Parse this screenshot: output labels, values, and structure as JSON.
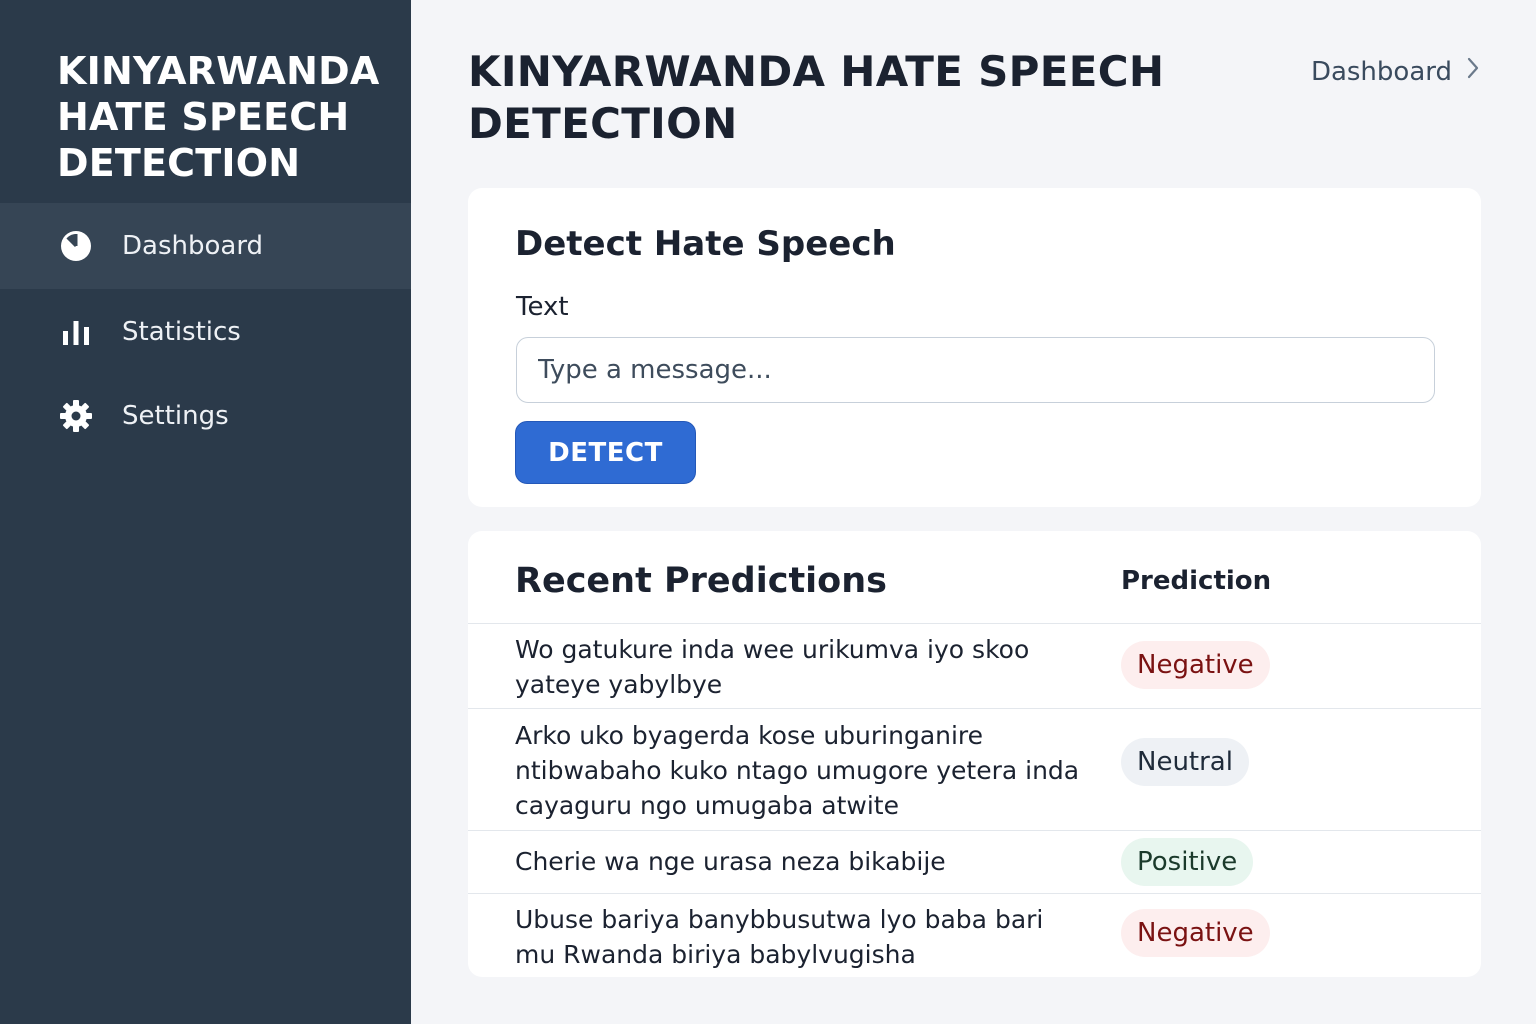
{
  "sidebar": {
    "brand_lines": [
      "KINYARWANDA",
      "HATE SPEECH",
      "DETECTION"
    ],
    "items": [
      {
        "label": "Dashboard",
        "icon": "clock-icon",
        "active": true
      },
      {
        "label": "Statistics",
        "icon": "bar-chart-icon",
        "active": false
      },
      {
        "label": "Settings",
        "icon": "gear-icon",
        "active": false
      }
    ]
  },
  "header": {
    "title_lines": [
      "KINYARWANDA HATE SPEECH",
      "DETECTION"
    ],
    "breadcrumb": "Dashboard",
    "breadcrumb_icon": "chevron-right-icon"
  },
  "detect": {
    "title": "Detect Hate Speech",
    "field_label": "Text",
    "placeholder": "Type a message...",
    "button_label": "DETECT"
  },
  "recent": {
    "title": "Recent Predictions",
    "column_header": "Prediction",
    "rows": [
      {
        "text": "Wo gatukure inda wee urikumva iyo skoo yateye yabylbye",
        "prediction": "Negative"
      },
      {
        "text": "Arko uko byagerda kose uburinganire ntibwabaho kuko ntago umugore yetera inda cayaguru ngo umugaba atwite",
        "prediction": "Neutral"
      },
      {
        "text": "Cherie wa nge urasa neza bikabije",
        "prediction": "Positive"
      },
      {
        "text": "Ubuse bariya banybbusutwa lyo baba bari mu Rwanda biriya babylvugisha",
        "prediction": "Negative"
      }
    ]
  },
  "colors": {
    "sidebar_bg": "#2b3a4a",
    "sidebar_active_bg": "#364555",
    "page_bg": "#f4f5f8",
    "primary_button": "#2f6bd3",
    "negative_bg": "#fdeeee",
    "negative_text": "#7a1212",
    "neutral_bg": "#eef1f5",
    "positive_bg": "#e8f6ef"
  }
}
